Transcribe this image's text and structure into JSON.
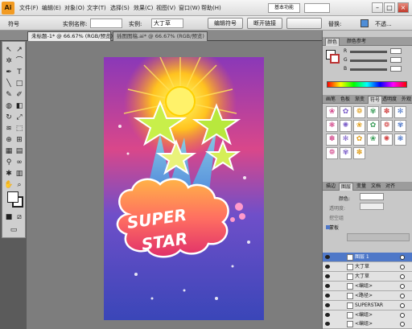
{
  "app": {
    "logo": "Ai"
  },
  "menu": [
    "文件(F)",
    "编辑(E)",
    "对象(O)",
    "文字(T)",
    "选择(S)",
    "效果(C)",
    "视图(V)",
    "窗口(W)",
    "帮助(H)"
  ],
  "workspace": {
    "label": "基本功能"
  },
  "window_controls": {
    "minimize": "–",
    "maximize": "□",
    "close": "×"
  },
  "control_bar": {
    "label_type": "符号",
    "instance_label": "实例名称:",
    "instance_value": "",
    "instance_text": "实例:",
    "symbol_name": "大丁草",
    "edit_symbol": "编辑符号",
    "break_link": "断开链接",
    "replace_label": "替换:",
    "fill_label": "不透..."
  },
  "tabs": [
    {
      "label": "未标题-1* @ 66.67% (RGB/预览)"
    },
    {
      "label": "插图图稿.ai* @ 66.67% (RGB/预览)"
    }
  ],
  "colors": {
    "accent": "#4f78c8",
    "menu_bg": "#e7e7e7",
    "panel_bg": "#c8c8c8"
  },
  "color_panel": {
    "tabs": [
      "颜色",
      "颜色参考"
    ],
    "channels": [
      "R",
      "G",
      "B"
    ]
  },
  "symbols_panel": {
    "tabs": [
      "画笔",
      "色板",
      "渐变",
      "符号",
      "透明度",
      "外观"
    ],
    "items": [
      "❀",
      "✿",
      "❁",
      "✾",
      "✽",
      "✻",
      "❃",
      "✺",
      "❀",
      "✿",
      "❁",
      "✾",
      "✽",
      "✻",
      "✿",
      "❀",
      "✺",
      "❃",
      "❁",
      "✾",
      "✽"
    ]
  },
  "layers_panel": {
    "tabs": [
      "描边",
      "图层",
      "变量",
      "文档",
      "对齐"
    ],
    "blend_label": "颜色:",
    "opacity_label": "透明度:",
    "option_label": "挖空组",
    "clip_label": "蒙板",
    "layers": [
      {
        "name": "图层 1",
        "selected": true
      },
      {
        "name": "大丁草",
        "selected": false
      },
      {
        "name": "大丁草",
        "selected": false
      },
      {
        "name": "<编组>",
        "selected": false
      },
      {
        "name": "<路径>",
        "selected": false
      },
      {
        "name": "SUPERSTAR",
        "selected": false
      },
      {
        "name": "<编组>",
        "selected": false
      },
      {
        "name": "<编组>",
        "selected": false
      }
    ]
  },
  "artwork": {
    "text_line1": "SUPER",
    "text_line2": "STAR"
  }
}
